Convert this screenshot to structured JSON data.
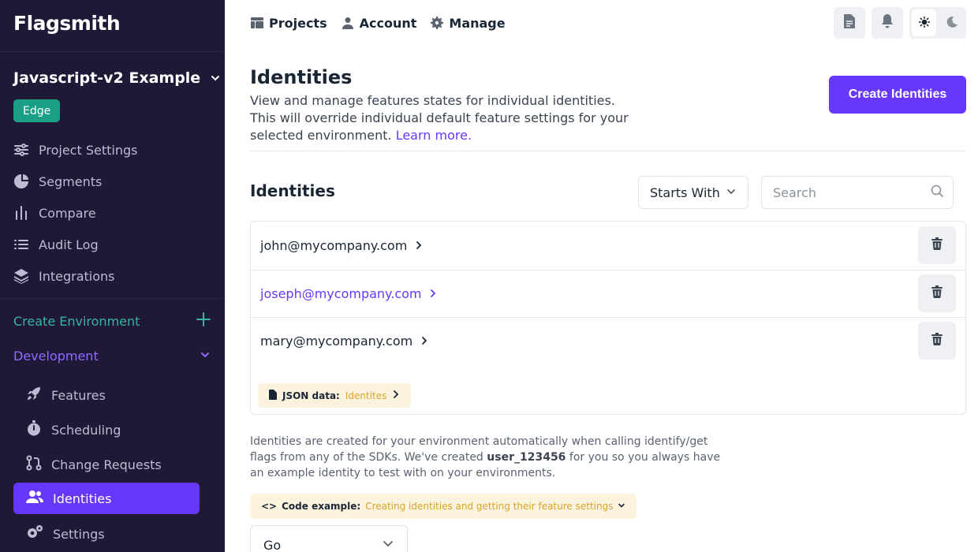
{
  "brand": {
    "logo_text": "Flagsmith"
  },
  "sidebar": {
    "project_name": "Javascript-v2 Example",
    "project_badge": "Edge",
    "project_items": [
      {
        "label": "Project Settings",
        "icon": "sliders-icon"
      },
      {
        "label": "Segments",
        "icon": "pie-chart-icon"
      },
      {
        "label": "Compare",
        "icon": "bar-chart-icon"
      },
      {
        "label": "Audit Log",
        "icon": "list-icon"
      },
      {
        "label": "Integrations",
        "icon": "layers-icon"
      }
    ],
    "create_environment": "Create Environment",
    "environment_name": "Development",
    "environment_items": [
      {
        "label": "Features",
        "icon": "rocket-icon"
      },
      {
        "label": "Scheduling",
        "icon": "stopwatch-icon"
      },
      {
        "label": "Change Requests",
        "icon": "git-pull-request-icon"
      },
      {
        "label": "Identities",
        "icon": "users-icon",
        "active": true
      },
      {
        "label": "Settings",
        "icon": "gears-icon"
      }
    ]
  },
  "topnav": {
    "links": [
      {
        "label": "Projects",
        "icon": "projects-icon"
      },
      {
        "label": "Account",
        "icon": "user-icon"
      },
      {
        "label": "Manage",
        "icon": "gear-icon"
      }
    ]
  },
  "main": {
    "title": "Identities",
    "description": "View and manage features states for individual identities. This will override individual default feature settings for your selected environment.",
    "learn_more": "Learn more.",
    "create_button": "Create Identities",
    "section_title": "Identities",
    "filter_label": "Starts With",
    "search_placeholder": "Search",
    "identities": [
      {
        "email": "john@mycompany.com",
        "highlight": false
      },
      {
        "email": "joseph@mycompany.com",
        "highlight": true
      },
      {
        "email": "mary@mycompany.com",
        "highlight": false
      }
    ],
    "json_chip": {
      "label": "JSON data:",
      "link": "Identites"
    },
    "info_part1": "Identities are created for your environment automatically when calling identify/get flags from any of the SDKs. We've created",
    "info_user": "user_123456",
    "info_part2": "for you so you always have an example identity to test with on your environments.",
    "code_chip": {
      "prefix": "<>",
      "label": "Code example:",
      "link": "Creating identities and getting their feature settings"
    },
    "language_select": "Go"
  },
  "colors": {
    "sidebar_bg": "#1f1837",
    "primary": "#6837fc",
    "edge_badge": "#199f86",
    "create_env": "#37b59e",
    "chip_bg": "#fbf3dd",
    "chip_link": "#d9a42b"
  }
}
